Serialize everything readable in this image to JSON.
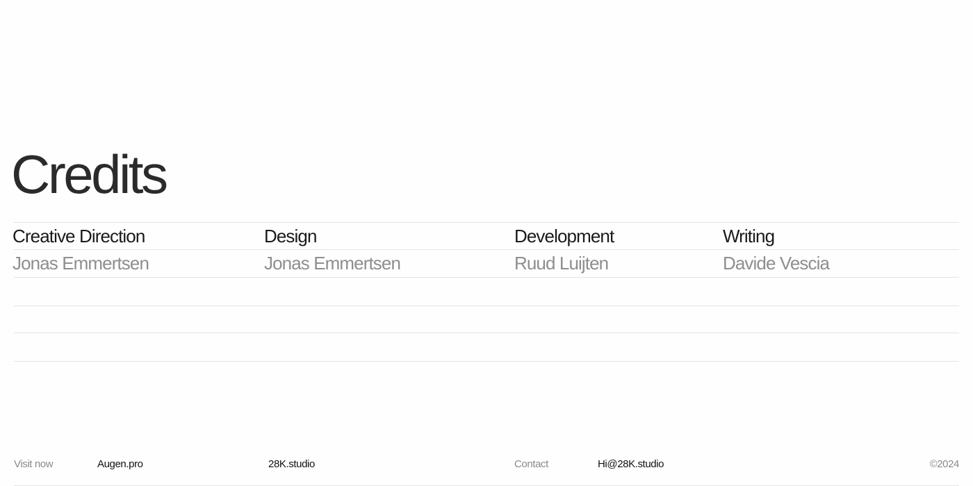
{
  "page": {
    "title": "Credits"
  },
  "credits": [
    {
      "role": "Creative Direction",
      "name": "Jonas Emmertsen"
    },
    {
      "role": "Design",
      "name": "Jonas Emmertsen"
    },
    {
      "role": "Development",
      "name": "Ruud Luijten"
    },
    {
      "role": "Writing",
      "name": "Davide Vescia"
    }
  ],
  "footer": {
    "visit_label": "Visit now",
    "visit_link_1": "Augen.pro",
    "visit_link_2": "28K.studio",
    "contact_label": "Contact",
    "contact_email": "Hi@28K.studio",
    "copyright": "©2024"
  },
  "colors": {
    "text": "#1a1a1a",
    "muted": "#8e8e8e",
    "divider": "#e3e3e3",
    "background": "#fefefe"
  }
}
